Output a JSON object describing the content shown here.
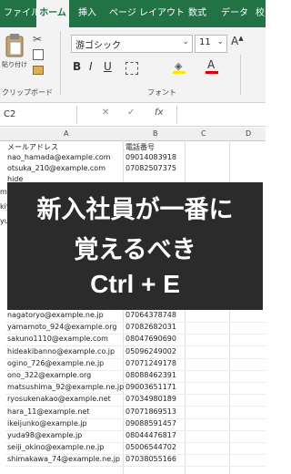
{
  "tabs": [
    "ファイル",
    "ホーム",
    "挿入",
    "ページ レイアウト",
    "数式",
    "データ",
    "校"
  ],
  "ribbon": {
    "paste_label": "貼り付け",
    "clipboard_label": "クリップボード",
    "font_name": "游ゴシック",
    "font_size": "11",
    "font_label": "フォント",
    "bold": "B",
    "italic": "I",
    "underline": "U",
    "font_color": "A"
  },
  "formula_bar": {
    "name_box": "C2",
    "fx": "fx",
    "cancel": "✕",
    "confirm": "✓"
  },
  "columns": [
    "A",
    "B",
    "C",
    "D"
  ],
  "headers": [
    "メールアドレス",
    "電話番号"
  ],
  "top_rows": [
    {
      "email": "nao_hamada@example.com",
      "phone": "09014083918"
    },
    {
      "email": "otsuka_210@example.com",
      "phone": "07082507375"
    }
  ],
  "hidden_prefixes": [
    "hide",
    "miki",
    "kiyo",
    "yua",
    "sas",
    "sas",
    "ot",
    "tak",
    "kaw",
    "kuk"
  ],
  "bottom_rows": [
    {
      "email": "nagatoryo@example.ne.jp",
      "phone": "07064378748"
    },
    {
      "email": "yamamoto_924@example.org",
      "phone": "07082682031"
    },
    {
      "email": "sakuno1110@example.com",
      "phone": "08047690690"
    },
    {
      "email": "hideakibanno@example.co.jp",
      "phone": "05096249002"
    },
    {
      "email": "ogino_726@example.ne.jp",
      "phone": "07071249178"
    },
    {
      "email": "ono_322@example.org",
      "phone": "08088462391"
    },
    {
      "email": "matsushima_92@example.ne.jp",
      "phone": "09003651171"
    },
    {
      "email": "ryosukenakao@example.net",
      "phone": "07034980189"
    },
    {
      "email": "hara_11@example.net",
      "phone": "07071869513"
    },
    {
      "email": "ikeijunko@example.jp",
      "phone": "09088591457"
    },
    {
      "email": "yuda98@example.jp",
      "phone": "08044476817"
    },
    {
      "email": "seiji_okino@example.ne.jp",
      "phone": "05006544702"
    },
    {
      "email": "shimakawa_74@example.ne.jp",
      "phone": "07038055166"
    }
  ],
  "overlay": {
    "line1": "新入社員が一番に",
    "line2": "覚えるべき",
    "line3": "Ctrl + E"
  },
  "colors": {
    "excel_green": "#217346",
    "overlay_bg": "#2b2b2b"
  }
}
